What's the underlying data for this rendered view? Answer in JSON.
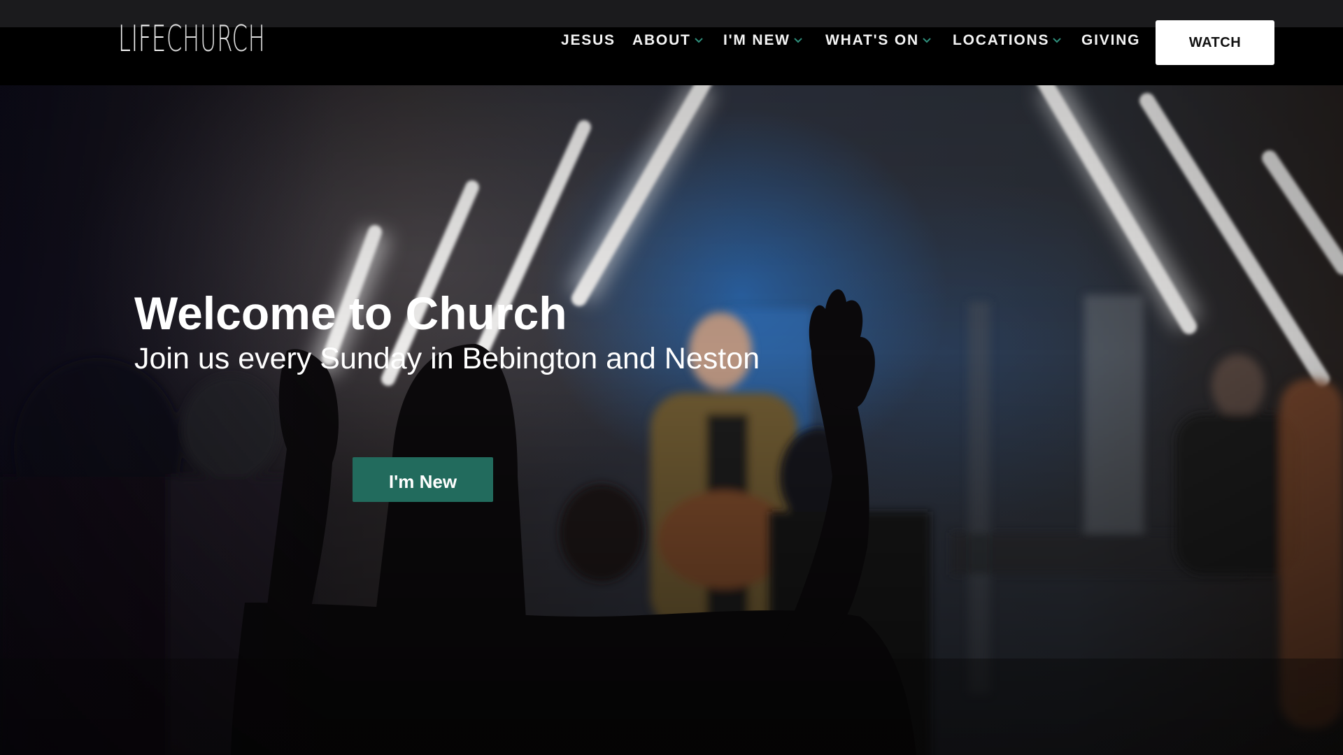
{
  "logo": {
    "part1": "LIFE",
    "part2": "CHURCH"
  },
  "nav": {
    "items": [
      {
        "label": "JESUS",
        "dropdown": false
      },
      {
        "label": "ABOUT",
        "dropdown": true
      },
      {
        "label": "I'M NEW",
        "dropdown": true
      },
      {
        "label": "WHAT'S ON",
        "dropdown": true
      },
      {
        "label": "LOCATIONS",
        "dropdown": true
      },
      {
        "label": "GIVING",
        "dropdown": false
      }
    ],
    "watch_label": "WATCH",
    "chevron_color": "#2f8f7c"
  },
  "hero": {
    "title": "Welcome to Church",
    "subtitle": "Join us every Sunday in Bebington and Neston",
    "cta_label": "I'm New",
    "cta_color": "#226b5d"
  }
}
